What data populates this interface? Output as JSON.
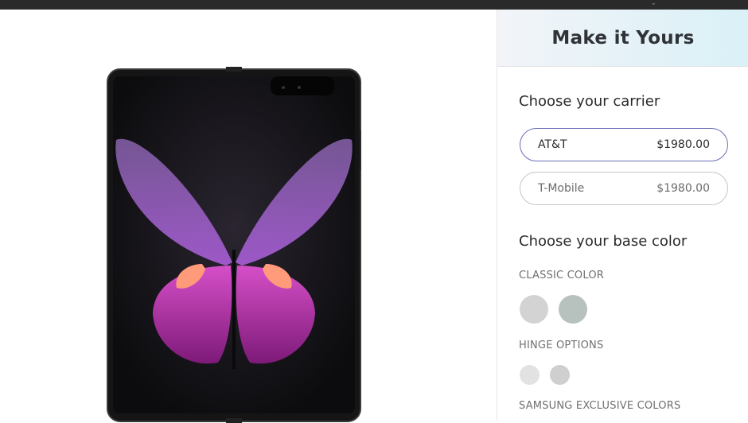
{
  "header": {
    "title": "Make it Yours"
  },
  "carrier": {
    "heading": "Choose your carrier",
    "options": [
      {
        "name": "AT&T",
        "price": "$1980.00",
        "selected": true
      },
      {
        "name": "T-Mobile",
        "price": "$1980.00",
        "selected": false
      }
    ]
  },
  "color": {
    "heading": "Choose your base color",
    "classic_label": "CLASSIC COLOR",
    "classic_swatches": [
      "#d3d3d3",
      "#b7c2be"
    ],
    "hinge_label": "HINGE OPTIONS",
    "hinge_swatches": [
      "#e2e2e2",
      "#cfcfcf"
    ],
    "exclusive_label": "SAMSUNG EXCLUSIVE COLORS"
  },
  "colors": {
    "accent_border": "#6a6db5",
    "header_gradient_end": "#d9f1f7"
  }
}
